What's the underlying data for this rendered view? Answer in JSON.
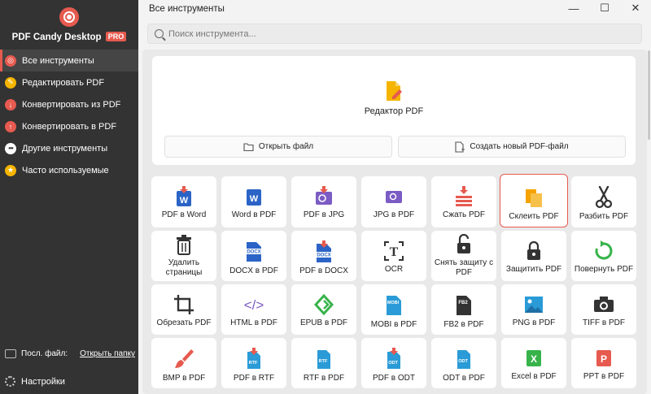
{
  "app": {
    "brand": "PDF Candy Desktop",
    "badge": "PRO"
  },
  "sidebar": {
    "items": [
      {
        "label": "Все инструменты",
        "icon": "all-tools-icon"
      },
      {
        "label": "Редактировать PDF",
        "icon": "edit-icon"
      },
      {
        "label": "Конвертировать из PDF",
        "icon": "download-arrow-icon"
      },
      {
        "label": "Конвертировать в PDF",
        "icon": "upload-arrow-icon"
      },
      {
        "label": "Другие инструменты",
        "icon": "more-icon"
      },
      {
        "label": "Часто используемые",
        "icon": "star-icon"
      }
    ],
    "last_file_label": "Посл. файл:",
    "open_folder_link": "Открыть папку",
    "settings_label": "Настройки"
  },
  "window": {
    "title": "Все инструменты",
    "minimize": "—",
    "maximize": "☐",
    "close": "✕"
  },
  "search": {
    "placeholder": "Поиск инструмента..."
  },
  "editor": {
    "label": "Редактор PDF",
    "open_file": "Открыть файл",
    "create_new": "Создать новый PDF-файл"
  },
  "tools": [
    {
      "label": "PDF в Word",
      "icon": "word-file-icon"
    },
    {
      "label": "Word в PDF",
      "icon": "word-icon"
    },
    {
      "label": "PDF в JPG",
      "icon": "image-file-icon"
    },
    {
      "label": "JPG в PDF",
      "icon": "image-icon"
    },
    {
      "label": "Сжать PDF",
      "icon": "compress-icon"
    },
    {
      "label": "Склеить PDF",
      "icon": "merge-icon"
    },
    {
      "label": "Разбить PDF",
      "icon": "scissors-icon"
    },
    {
      "label": "Удалить страницы",
      "icon": "trash-icon"
    },
    {
      "label": "DOCX в PDF",
      "icon": "docx-icon"
    },
    {
      "label": "PDF в DOCX",
      "icon": "docx-file-icon"
    },
    {
      "label": "OCR",
      "icon": "ocr-icon"
    },
    {
      "label": "Снять защиту с PDF",
      "icon": "unlock-icon"
    },
    {
      "label": "Защитить PDF",
      "icon": "lock-icon"
    },
    {
      "label": "Повернуть PDF",
      "icon": "rotate-icon"
    },
    {
      "label": "Обрезать PDF",
      "icon": "crop-icon"
    },
    {
      "label": "HTML в PDF",
      "icon": "code-icon"
    },
    {
      "label": "EPUB в PDF",
      "icon": "epub-icon"
    },
    {
      "label": "MOBI в PDF",
      "icon": "mobi-icon"
    },
    {
      "label": "FB2 в PDF",
      "icon": "fb2-icon"
    },
    {
      "label": "PNG в PDF",
      "icon": "png-icon"
    },
    {
      "label": "TIFF в PDF",
      "icon": "camera-icon"
    },
    {
      "label": "BMP в PDF",
      "icon": "brush-icon"
    },
    {
      "label": "PDF в RTF",
      "icon": "rtf-file-icon"
    },
    {
      "label": "RTF в PDF",
      "icon": "rtf-icon"
    },
    {
      "label": "PDF в ODT",
      "icon": "odt-file-icon"
    },
    {
      "label": "ODT в PDF",
      "icon": "odt-icon"
    },
    {
      "label": "Excel в PDF",
      "icon": "excel-icon"
    },
    {
      "label": "PPT в PDF",
      "icon": "powerpoint-icon"
    }
  ],
  "tag_labels": {
    "docx": "DOCX",
    "mobi": "MOBI",
    "fb2": "FB2",
    "rtf": "RTF",
    "odt": "ODT",
    "word": "W",
    "excel": "X",
    "ppt": "P",
    "ocr": "T",
    "html": "</>"
  },
  "colors": {
    "accent": "#e65a4f",
    "sidebar_bg": "#333333",
    "word_blue": "#2b64c6",
    "purple": "#7b5bc4",
    "orange": "#f5a300",
    "green": "#37b34a",
    "teal": "#2a9bd7"
  }
}
